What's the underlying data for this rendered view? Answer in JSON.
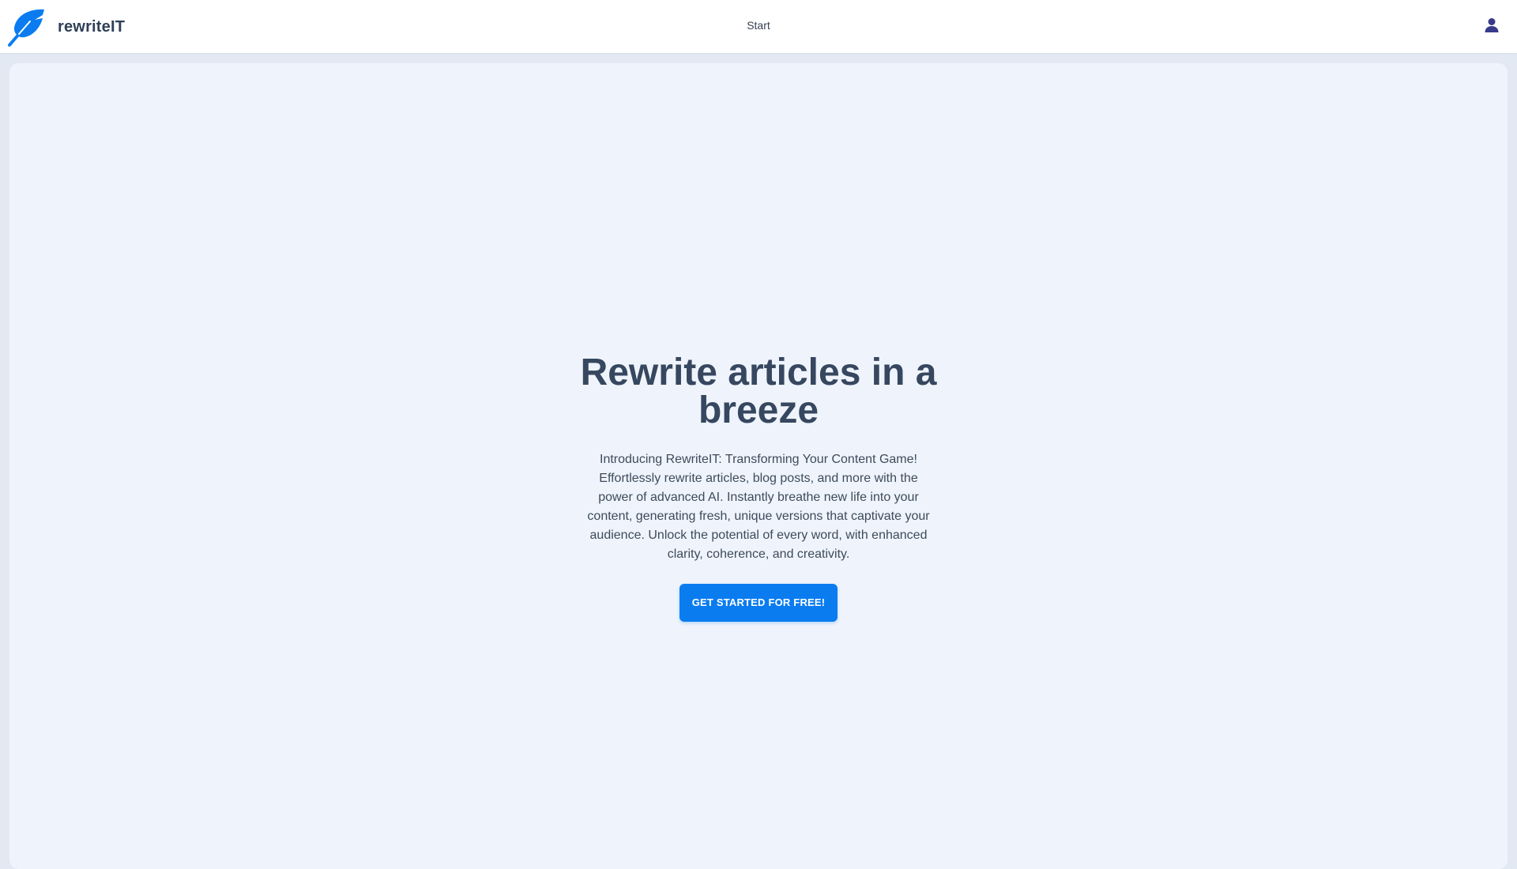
{
  "header": {
    "brand_name": "rewriteIT",
    "logo_icon": "feather-icon",
    "nav_start": "Start",
    "user_icon": "user-icon"
  },
  "hero": {
    "title": "Rewrite articles in a breeze",
    "description": "Introducing RewriteIT: Transforming Your Content Game! Effortlessly rewrite articles, blog posts, and more with the power of advanced AI. Instantly breathe new life into your content, generating fresh, unique versions that captivate your audience. Unlock the potential of every word, with enhanced clarity, coherence, and creativity.",
    "cta_label": "GET STARTED FOR FREE!"
  },
  "colors": {
    "brand_blue": "#0a7cf0",
    "heading": "#36475f",
    "panel_bg": "#eff4fc",
    "page_bg": "#e3e9f3",
    "user_icon": "#3a3a8c"
  }
}
